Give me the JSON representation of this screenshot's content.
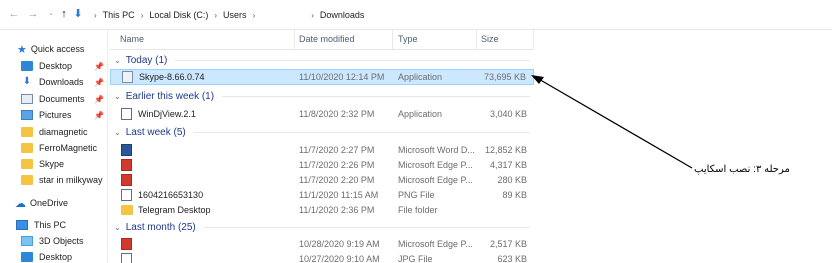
{
  "breadcrumb": [
    "This PC",
    "Local Disk (C:)",
    "Users",
    "",
    "Downloads"
  ],
  "columns": {
    "name": "Name",
    "date": "Date modified",
    "type": "Type",
    "size": "Size"
  },
  "sidebar": {
    "quick_access": "Quick access",
    "items": [
      {
        "label": "Desktop",
        "pinned": true,
        "icon": "desktop-icon"
      },
      {
        "label": "Downloads",
        "pinned": true,
        "icon": "downloads-icon"
      },
      {
        "label": "Documents",
        "pinned": true,
        "icon": "documents-icon"
      },
      {
        "label": "Pictures",
        "pinned": true,
        "icon": "pictures-icon"
      },
      {
        "label": "diamagnetic",
        "pinned": false,
        "icon": "folder-icon"
      },
      {
        "label": "FerroMagnetic",
        "pinned": false,
        "icon": "folder-icon"
      },
      {
        "label": "Skype",
        "pinned": false,
        "icon": "folder-icon"
      },
      {
        "label": "star in milkyway",
        "pinned": false,
        "icon": "folder-icon"
      }
    ],
    "onedrive": "OneDrive",
    "this_pc": "This PC",
    "pc_items": [
      "3D Objects",
      "Desktop"
    ]
  },
  "groups": [
    {
      "label": "Today (1)"
    },
    {
      "label": "Earlier this week (1)"
    },
    {
      "label": "Last week (5)"
    },
    {
      "label": "Last month (25)"
    }
  ],
  "files": [
    {
      "name": "Skype-8.66.0.74",
      "date": "11/10/2020 12:14 PM",
      "type": "Application",
      "size": "73,695 KB",
      "icon": "skype-installer-icon"
    },
    {
      "name": "WinDjView.2.1",
      "date": "11/8/2020 2:32 PM",
      "type": "Application",
      "size": "3,040 KB",
      "icon": "windjview-icon"
    },
    {
      "name": "",
      "date": "11/7/2020 2:27 PM",
      "type": "Microsoft Word D...",
      "size": "12,852 KB",
      "icon": "word-doc-icon"
    },
    {
      "name": "",
      "date": "11/7/2020 2:26 PM",
      "type": "Microsoft Edge P...",
      "size": "4,317 KB",
      "icon": "pdf-icon"
    },
    {
      "name": "",
      "date": "11/7/2020 2:20 PM",
      "type": "Microsoft Edge P...",
      "size": "280 KB",
      "icon": "pdf-icon"
    },
    {
      "name": "1604216653130",
      "date": "11/1/2020 11:15 AM",
      "type": "PNG File",
      "size": "89 KB",
      "icon": "png-icon"
    },
    {
      "name": "Telegram Desktop",
      "date": "11/1/2020 2:36 PM",
      "type": "File folder",
      "size": "",
      "icon": "folder-icon"
    },
    {
      "name": "",
      "date": "10/28/2020 9:19 AM",
      "type": "Microsoft Edge P...",
      "size": "2,517 KB",
      "icon": "pdf-icon"
    },
    {
      "name": "",
      "date": "10/27/2020 9:10 AM",
      "type": "JPG File",
      "size": "623 KB",
      "icon": "jpg-icon"
    }
  ],
  "annotation": "مرحله ۳: نصب اسکایپ",
  "colors": {
    "selected_bg": "#cce8ff",
    "group_text": "#1e3a8a",
    "folder": "#f5c542",
    "pdf_red": "#d23a2e",
    "word_blue": "#2b579a"
  }
}
